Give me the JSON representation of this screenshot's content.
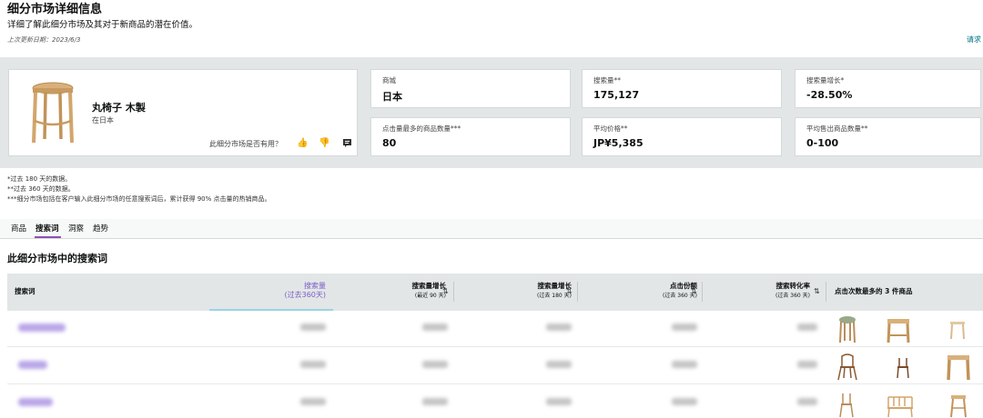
{
  "header": {
    "title": "细分市场详细信息",
    "subtitle": "详细了解此细分市场及其对于新商品的潜在价值。",
    "updated": "上次更新日期：2023/6/3",
    "right_link": "请求"
  },
  "product": {
    "name": "丸椅子 木製",
    "market": "在日本",
    "useful_prompt": "此细分市场是否有用？"
  },
  "stats": [
    {
      "label": "商城",
      "value": "日本"
    },
    {
      "label": "搜索量**",
      "value": "175,127"
    },
    {
      "label": "搜索量增长*",
      "value": "-28.50%"
    },
    {
      "label": "点击量最多的商品数量***",
      "value": "80"
    },
    {
      "label": "平均价格**",
      "value": "JP¥5,385"
    },
    {
      "label": "平均售出商品数量**",
      "value": "0-100"
    }
  ],
  "notes": [
    "*过去 180 天的数据。",
    "**过去 360 天的数据。",
    "***细分市场包括在客户输入此细分市场的任意搜索词后，累计获得 90% 点击量的热销商品。"
  ],
  "tabs": [
    "商品",
    "搜索词",
    "洞察",
    "趋势"
  ],
  "active_tab": "搜索词",
  "section_title": "此细分市场中的搜索词",
  "table": {
    "col_keyword": "搜索词",
    "col_volume": "搜索量",
    "col_volume_sub": "(过去360天)",
    "col_growth90": "搜索量增长",
    "col_growth90_sub": "(最近 90 天)",
    "col_growth180": "搜索量增长",
    "col_growth180_sub": "(过去 180 天)",
    "col_share": "点击份额",
    "col_share_sub": "(过去 360 天)",
    "col_conv": "搜索转化率",
    "col_conv_sub": "(过去 360 天)",
    "col_top": "点击次数最多的 3 件商品",
    "row_count": 3
  },
  "colors": {
    "accent": "#8c50b5",
    "link": "#007185",
    "band": "#e3e6e6",
    "wood": "#d9b07a"
  }
}
